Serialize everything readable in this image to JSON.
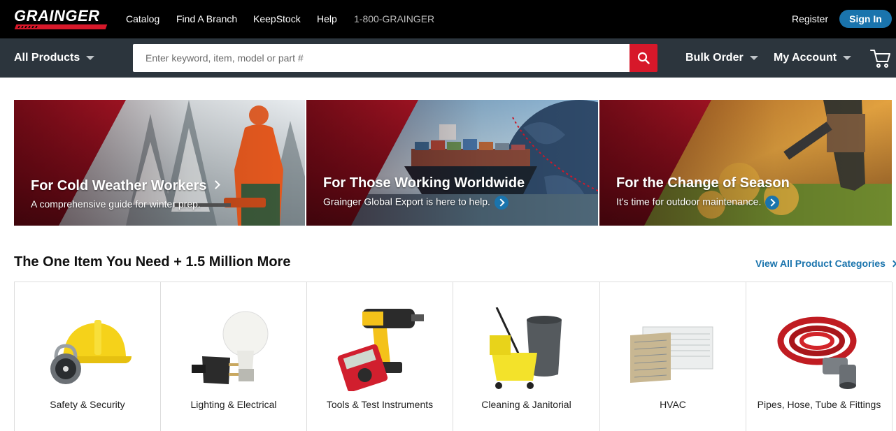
{
  "brand": {
    "name": "GRAINGER",
    "red": "#d7182a",
    "blue": "#1a74ad",
    "dark": "#2c353d"
  },
  "topnav": {
    "items": [
      "Catalog",
      "Find A Branch",
      "KeepStock",
      "Help"
    ],
    "phone": "1-800-GRAINGER",
    "register": "Register",
    "signin": "Sign In"
  },
  "navbar": {
    "all_products": "All Products",
    "search_placeholder": "Enter keyword, item, model or part #",
    "bulk_order": "Bulk Order",
    "my_account": "My Account",
    "icons": [
      "search-icon",
      "cart-icon",
      "caret-down-icon"
    ]
  },
  "banners": [
    {
      "title": "For Cold Weather Workers",
      "subtitle": "A comprehensive guide for winter prep."
    },
    {
      "title": "For Those Working Worldwide",
      "subtitle": "Grainger Global Export is here to help."
    },
    {
      "title": "For the Change of Season",
      "subtitle": "It's time for outdoor maintenance."
    }
  ],
  "section": {
    "title": "The One Item You Need + 1.5 Million More",
    "view_all": "View All Product Categories"
  },
  "categories": [
    {
      "label": "Safety & Security",
      "icon": "hardhat-padlock-icon"
    },
    {
      "label": "Lighting & Electrical",
      "icon": "bulb-plug-icon"
    },
    {
      "label": "Tools & Test Instruments",
      "icon": "drill-multimeter-icon"
    },
    {
      "label": "Cleaning & Janitorial",
      "icon": "mop-bucket-icon"
    },
    {
      "label": "HVAC",
      "icon": "air-conditioner-icon"
    },
    {
      "label": "Pipes, Hose, Tube & Fittings",
      "icon": "hose-fitting-icon"
    }
  ]
}
